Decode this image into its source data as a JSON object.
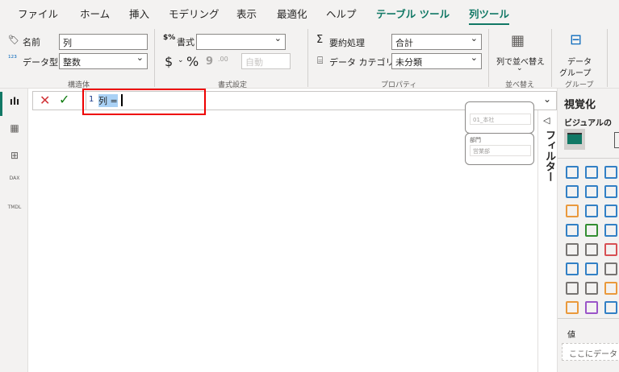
{
  "tabs": [
    "ファイル",
    "ホーム",
    "挿入",
    "モデリング",
    "表示",
    "最適化",
    "ヘルプ",
    "テーブル ツール",
    "列ツール"
  ],
  "structure": {
    "name_label": "名前",
    "name_value": "列",
    "datatype_label": "データ型",
    "datatype_value": "整数",
    "group": "構造体"
  },
  "format": {
    "format_label": "書式",
    "format_value": "",
    "dollar": "$",
    "percent": "%",
    "comma": "9",
    "decimals": ".00",
    "auto": "自動",
    "group": "書式設定"
  },
  "properties": {
    "summarize_label": "要約処理",
    "summarize_value": "合計",
    "category_label": "データ カテゴリ",
    "category_value": "未分類",
    "group": "プロパティ"
  },
  "sort": {
    "label": "列で並べ替え",
    "group": "並べ替え"
  },
  "groups": {
    "label1": "データ",
    "label2": "グループ",
    "group": "グループ"
  },
  "rail": [
    "report-view",
    "table-view",
    "model-view",
    "dax-query-view",
    "tmdl-view"
  ],
  "rail_labels": {
    "dax": "DAX",
    "tmdl": "TMDL"
  },
  "formula": {
    "line": "1",
    "text": "列 ="
  },
  "slicers": [
    {
      "title": "",
      "value": "01_本社"
    },
    {
      "title": "部門",
      "value": "営業部"
    }
  ],
  "filter_pane": "フィルター",
  "vis_pane": {
    "title": "視覚化",
    "subtitle": "ビジュアルの",
    "values_label": "値",
    "drop_placeholder": "ここにデータ"
  },
  "colors": {
    "accent": "#117865",
    "highlight": "#e00000",
    "selection": "#a9d1f5"
  }
}
